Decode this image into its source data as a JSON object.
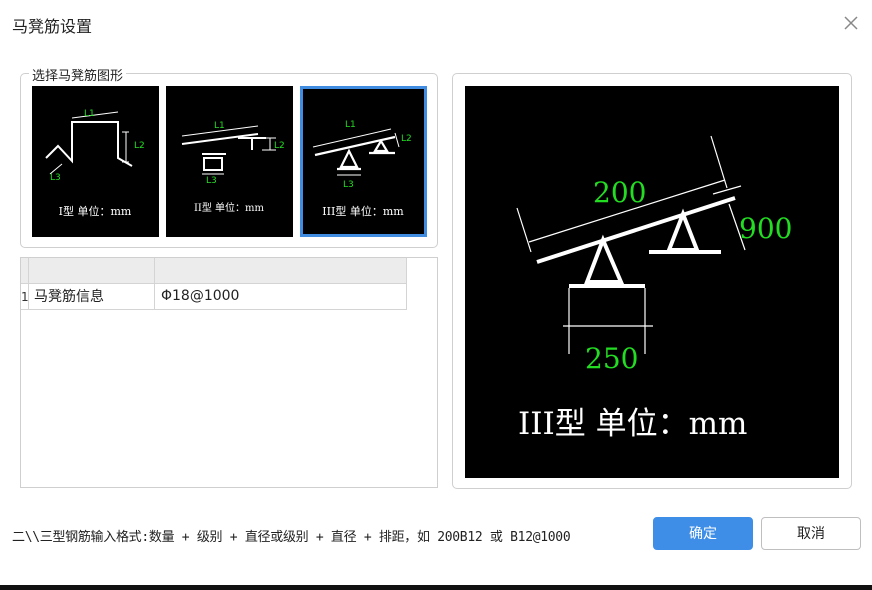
{
  "dialog": {
    "title": "马凳筋设置"
  },
  "shape_group": {
    "legend": "选择马凳筋图形",
    "options": [
      {
        "caption": "I型 单位：mm",
        "dims": [
          "L1",
          "L2",
          "L3"
        ],
        "selected": false
      },
      {
        "caption": "II型 单位：mm",
        "dims": [
          "L1",
          "L2",
          "L3"
        ],
        "selected": false
      },
      {
        "caption": "III型 单位：mm",
        "dims": [
          "L1",
          "L2",
          "L3"
        ],
        "selected": true
      }
    ]
  },
  "table": {
    "headers": [
      "",
      ""
    ],
    "rows": [
      {
        "index": "1",
        "name": "马凳筋信息",
        "value": "Φ18@1000"
      }
    ]
  },
  "preview": {
    "caption": "III型 单位：mm",
    "dims": {
      "length": "200",
      "height": "900",
      "base": "250"
    }
  },
  "footer": {
    "format_hint": "二\\\\三型钢筋输入格式:数量 + 级别 + 直径或级别 + 直径 + 排距，如 200B12 或 B12@1000",
    "ok_label": "确定",
    "cancel_label": "取消"
  },
  "colors": {
    "accent": "#3e8ee8",
    "dim_text": "#22dd22",
    "line": "#ffffff"
  }
}
